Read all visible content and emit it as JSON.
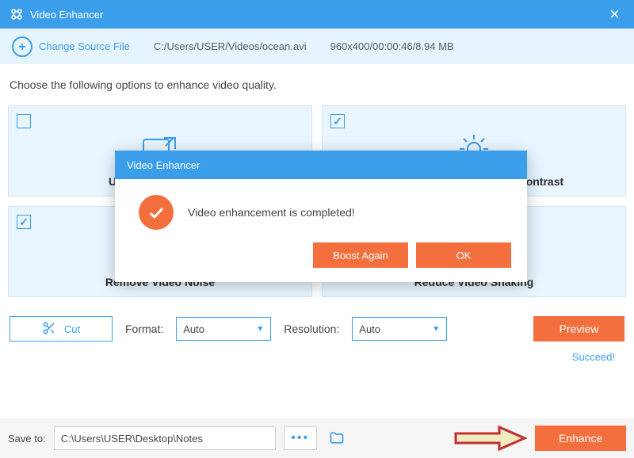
{
  "app": {
    "title": "Video Enhancer"
  },
  "source": {
    "change_label": "Change Source File",
    "path": "C:/Users/USER/Videos/ocean.avi",
    "info": "960x400/00:00:46/8.94 MB"
  },
  "intro": "Choose the following options to enhance video quality.",
  "tiles": {
    "upscale": "Upscale Resolution",
    "brightness": "Optimize Brightness and Contrast",
    "noise": "Remove Video Noise",
    "shaking": "Reduce Video Shaking"
  },
  "controls": {
    "cut": "Cut",
    "format_label": "Format:",
    "format_value": "Auto",
    "resolution_label": "Resolution:",
    "resolution_value": "Auto",
    "preview": "Preview"
  },
  "status": "Succeed!",
  "save": {
    "label": "Save to:",
    "path": "C:\\Users\\USER\\Desktop\\Notes",
    "enhance": "Enhance"
  },
  "modal": {
    "title": "Video Enhancer",
    "message": "Video enhancement is completed!",
    "boost_again": "Boost Again",
    "ok": "OK"
  }
}
